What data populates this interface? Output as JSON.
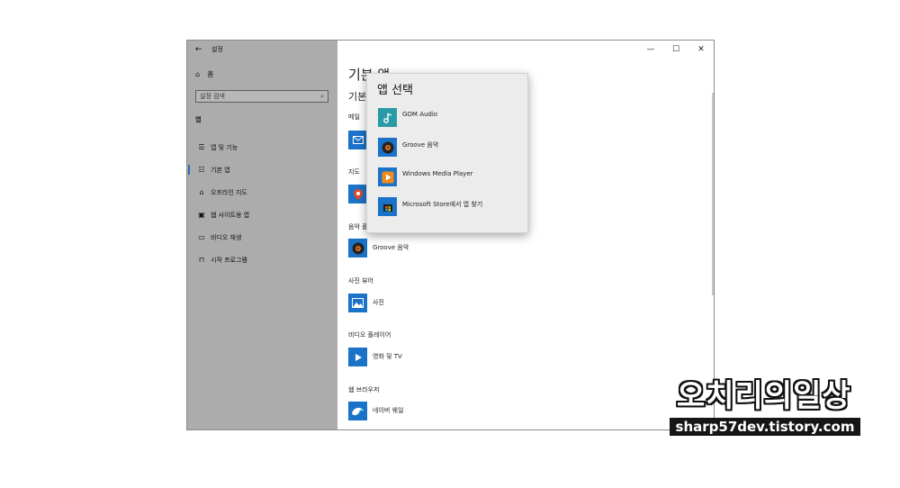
{
  "window": {
    "app_title": "설정",
    "controls": {
      "minimize": "—",
      "maximize": "☐",
      "close": "✕"
    }
  },
  "sidebar": {
    "home_label": "홈",
    "search_placeholder": "설정 검색",
    "section": "앱",
    "items": [
      {
        "label": "앱 및 기능",
        "icon": "apps-list-icon",
        "glyph": "☰"
      },
      {
        "label": "기본 앱",
        "icon": "default-apps-icon",
        "glyph": "☷",
        "active": true
      },
      {
        "label": "오프라인 지도",
        "icon": "offline-maps-icon",
        "glyph": "⌂"
      },
      {
        "label": "웹 사이트용 앱",
        "icon": "web-apps-icon",
        "glyph": "▣"
      },
      {
        "label": "비디오 재생",
        "icon": "video-playback-icon",
        "glyph": "▭"
      },
      {
        "label": "시작 프로그램",
        "icon": "startup-icon",
        "glyph": "⊓"
      }
    ]
  },
  "main": {
    "title": "기본 앱",
    "subtitle": "기본",
    "categories": {
      "email": "메일",
      "maps": "지도",
      "music": "음악 플",
      "photo": "사진 뷰어",
      "video": "비디오 플레이어",
      "web": "웹 브라우저"
    },
    "apps": {
      "music": "Groove 음악",
      "photo": "사진",
      "video": "영화 및 TV",
      "web": "네이버 웨일"
    }
  },
  "popup": {
    "title": "앱 선택",
    "items": [
      {
        "label": "GOM Audio",
        "icon": "gom-audio-icon"
      },
      {
        "label": "Groove 음악",
        "icon": "groove-music-icon"
      },
      {
        "label": "Windows Media Player",
        "icon": "windows-media-player-icon"
      },
      {
        "label": "Microsoft Store에서 앱 찾기",
        "icon": "microsoft-store-icon"
      }
    ]
  },
  "watermark": {
    "title": "오치리의일상",
    "url": "sharp57dev.tistory.com"
  },
  "colors": {
    "sidebar_bg": "#acacac",
    "accent": "#1a73c8",
    "popup_bg": "#ececec"
  }
}
